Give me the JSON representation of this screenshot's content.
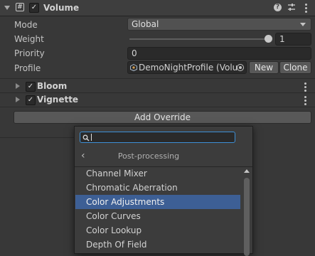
{
  "header": {
    "title": "Volume",
    "enabled": true,
    "icons": [
      "help-icon",
      "presets-icon",
      "menu-icon"
    ]
  },
  "fields": [
    {
      "label": "Mode",
      "kind": "dropdown",
      "value": "Global"
    },
    {
      "label": "Weight",
      "kind": "slider",
      "value": "1",
      "fraction": 1.0
    },
    {
      "label": "Priority",
      "kind": "text",
      "value": "0"
    },
    {
      "label": "Profile",
      "kind": "object",
      "value": "DemoNightProfile (Volun"
    }
  ],
  "profile_buttons": {
    "new": "New",
    "clone": "Clone"
  },
  "overrides": [
    {
      "label": "Bloom",
      "enabled": true
    },
    {
      "label": "Vignette",
      "enabled": true
    }
  ],
  "add_override": "Add Override",
  "popup": {
    "search": {
      "value": "",
      "placeholder": ""
    },
    "back_arrow": "‹",
    "category": "Post-processing",
    "selected": "Color Adjustments",
    "items": [
      "Channel Mixer",
      "Chromatic Aberration",
      "Color Adjustments",
      "Color Curves",
      "Color Lookup",
      "Depth Of Field"
    ]
  },
  "colors": {
    "selection": "#3d5f95",
    "background": "#383838",
    "header": "#3e3e3e"
  }
}
